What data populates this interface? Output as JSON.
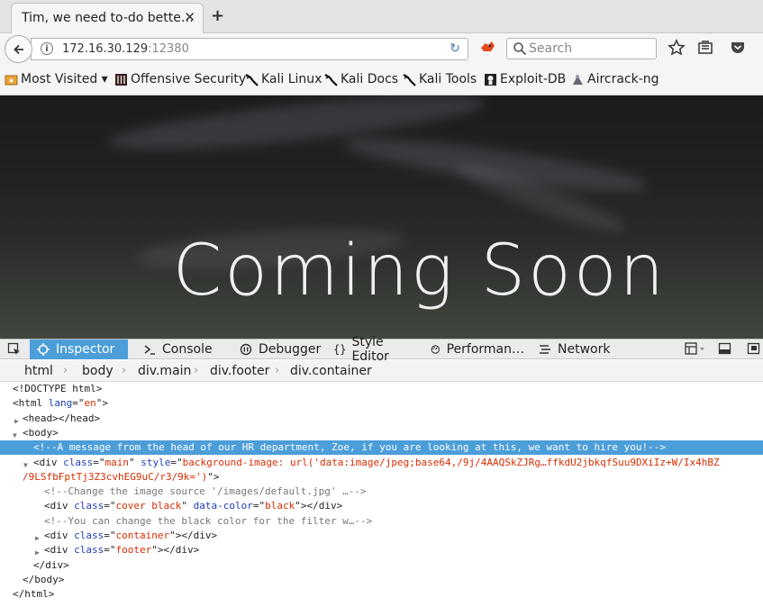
{
  "browser": {
    "tab_title": "Tim, we need to-do bette…",
    "url_host": "172.16.30.129",
    "url_port": ":12380",
    "search_placeholder": "Search"
  },
  "bookmarks": [
    {
      "label": "Most Visited ▾",
      "icon": "folder-star-icon"
    },
    {
      "label": "Offensive Security",
      "icon": "offsec-icon"
    },
    {
      "label": "Kali Linux",
      "icon": "kali-dragon-icon"
    },
    {
      "label": "Kali Docs",
      "icon": "kali-dragon-icon"
    },
    {
      "label": "Kali Tools",
      "icon": "kali-dragon-icon"
    },
    {
      "label": "Exploit-DB",
      "icon": "exploitdb-icon"
    },
    {
      "label": "Aircrack-ng",
      "icon": "aircrack-icon"
    }
  ],
  "page": {
    "heading": "Coming Soon"
  },
  "devtools": {
    "tabs": [
      {
        "label": "Inspector",
        "icon": "inspector-icon",
        "active": true
      },
      {
        "label": "Console",
        "icon": "console-icon",
        "active": false
      },
      {
        "label": "Debugger",
        "icon": "debugger-icon",
        "active": false
      },
      {
        "label": "Style Editor",
        "icon": "style-editor-icon",
        "active": false
      },
      {
        "label": "Performan…",
        "icon": "performance-icon",
        "active": false
      },
      {
        "label": "Network",
        "icon": "network-icon",
        "active": false
      }
    ],
    "breadcrumbs": [
      "html",
      "body",
      "div.main",
      "div.footer",
      "div.container"
    ],
    "markup": {
      "doctype": "<!DOCTYPE html>",
      "html_tag": "html",
      "lang_attr": "lang",
      "lang_val": "en",
      "head_tag": "<head></head>",
      "body_open": "<body>",
      "hr_comment": "<!--A message from the head of our HR department, Zoe, if you are looking at this, we want to hire you!-->",
      "div_tag": "div",
      "class_attr": "class",
      "style_attr": "style",
      "main_class": "main",
      "main_style_1": "background-image: url('data:image/jpeg;base64,/9j/4AAQSkZJRg…ffkdU2jbkqfSuu9DXiIz+W/Ix4hBZ",
      "main_style_2": "/9LSfbFptTj3Z3cvhEG9uC/r3/9k=')",
      "img_comment": "<!--Change the image source '/images/default.jpg' …-->",
      "cover_class": "cover black",
      "data_color_attr": "data-color",
      "data_color_val": "black",
      "filter_comment": "<!--You can change the black color for the filter w…-->",
      "container_class": "container",
      "footer_class": "footer",
      "div_close": "</div>",
      "body_close": "</body>",
      "html_close": "</html>"
    }
  }
}
